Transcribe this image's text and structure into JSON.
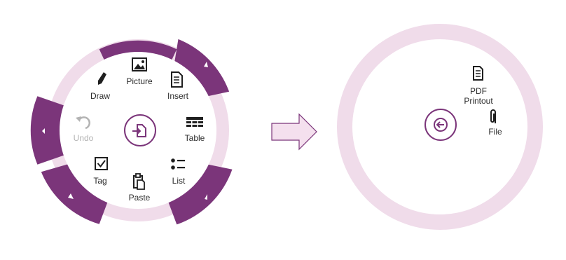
{
  "menu_expanded": {
    "items": {
      "picture": "Picture",
      "draw": "Draw",
      "insert": "Insert",
      "undo": "Undo",
      "table": "Table",
      "tag": "Tag",
      "list": "List",
      "paste": "Paste"
    },
    "center_icon": "insert-page-icon"
  },
  "menu_submenu": {
    "items": {
      "pdf_printout_line1": "PDF",
      "pdf_printout_line2": "Printout",
      "file": "File"
    },
    "center_icon": "back-arrow-icon"
  },
  "transition_arrow": "right-arrow-icon",
  "colors": {
    "ring_light": "#f0dcea",
    "segment_dark": "#7b357a",
    "accent": "#7b357a",
    "text": "#2b2b2b",
    "disabled_text": "#b3b3b3",
    "arrow_fill": "#f4e0ee"
  }
}
